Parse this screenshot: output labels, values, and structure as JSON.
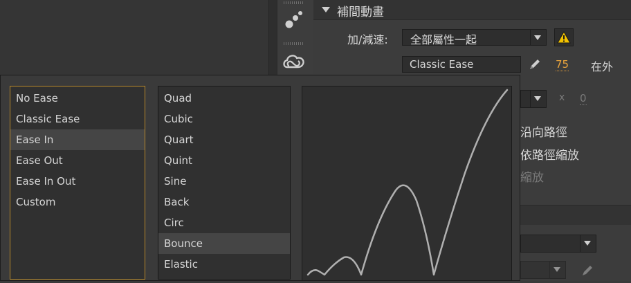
{
  "panel": {
    "section_title": "補間動畫",
    "ease_label": "加/減速:",
    "ease_dropdown_value": "全部屬性一起",
    "ease_type_value": "Classic Ease",
    "ease_amount": "75",
    "ease_direction": "在外",
    "x_label": "x",
    "x_value": "0",
    "orient_to_path": "沿向路徑",
    "scale_along_path": "依路徑縮放",
    "scale_partial": "縮放"
  },
  "ease_types": [
    {
      "label": "No Ease"
    },
    {
      "label": "Classic Ease"
    },
    {
      "label": "Ease In",
      "selected": true
    },
    {
      "label": "Ease Out"
    },
    {
      "label": "Ease In Out"
    },
    {
      "label": "Custom"
    }
  ],
  "ease_curves": [
    {
      "label": "Quad"
    },
    {
      "label": "Cubic"
    },
    {
      "label": "Quart"
    },
    {
      "label": "Quint"
    },
    {
      "label": "Sine"
    },
    {
      "label": "Back"
    },
    {
      "label": "Circ"
    },
    {
      "label": "Bounce",
      "selected": true
    },
    {
      "label": "Elastic"
    }
  ],
  "colors": {
    "accent_orange": "#e8a33c",
    "warning_yellow": "#f2c200",
    "curve_stroke": "#b0b0b0"
  },
  "icons": [
    "motion-dots-icon",
    "creative-cloud-icon",
    "warning-icon",
    "pencil-icon",
    "dropdown-arrow-icon",
    "collapse-triangle-icon"
  ]
}
